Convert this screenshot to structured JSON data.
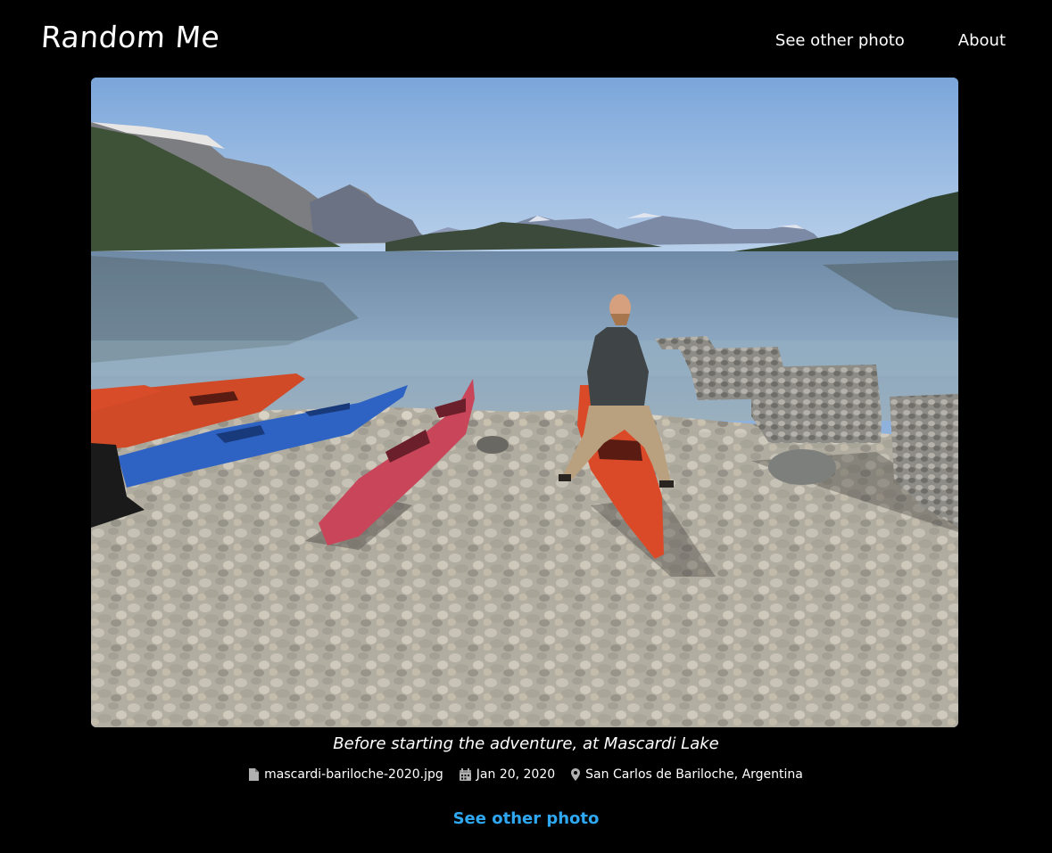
{
  "header": {
    "brand": "Random Me",
    "nav": [
      {
        "label": "See other photo"
      },
      {
        "label": "About"
      }
    ]
  },
  "photo": {
    "caption": "Before starting the adventure, at Mascardi Lake",
    "filename": "mascardi-bariloche-2020.jpg",
    "date": "Jan 20, 2020",
    "location": "San Carlos de Bariloche, Argentina"
  },
  "cta": {
    "label": "See other photo"
  },
  "icons": {
    "file": "file-icon",
    "calendar": "calendar-icon",
    "location": "map-marker-icon"
  },
  "colors": {
    "background": "#000000",
    "text": "#ffffff",
    "link_accent": "#2ea8f2",
    "meta_icon": "#b0b0b0"
  }
}
